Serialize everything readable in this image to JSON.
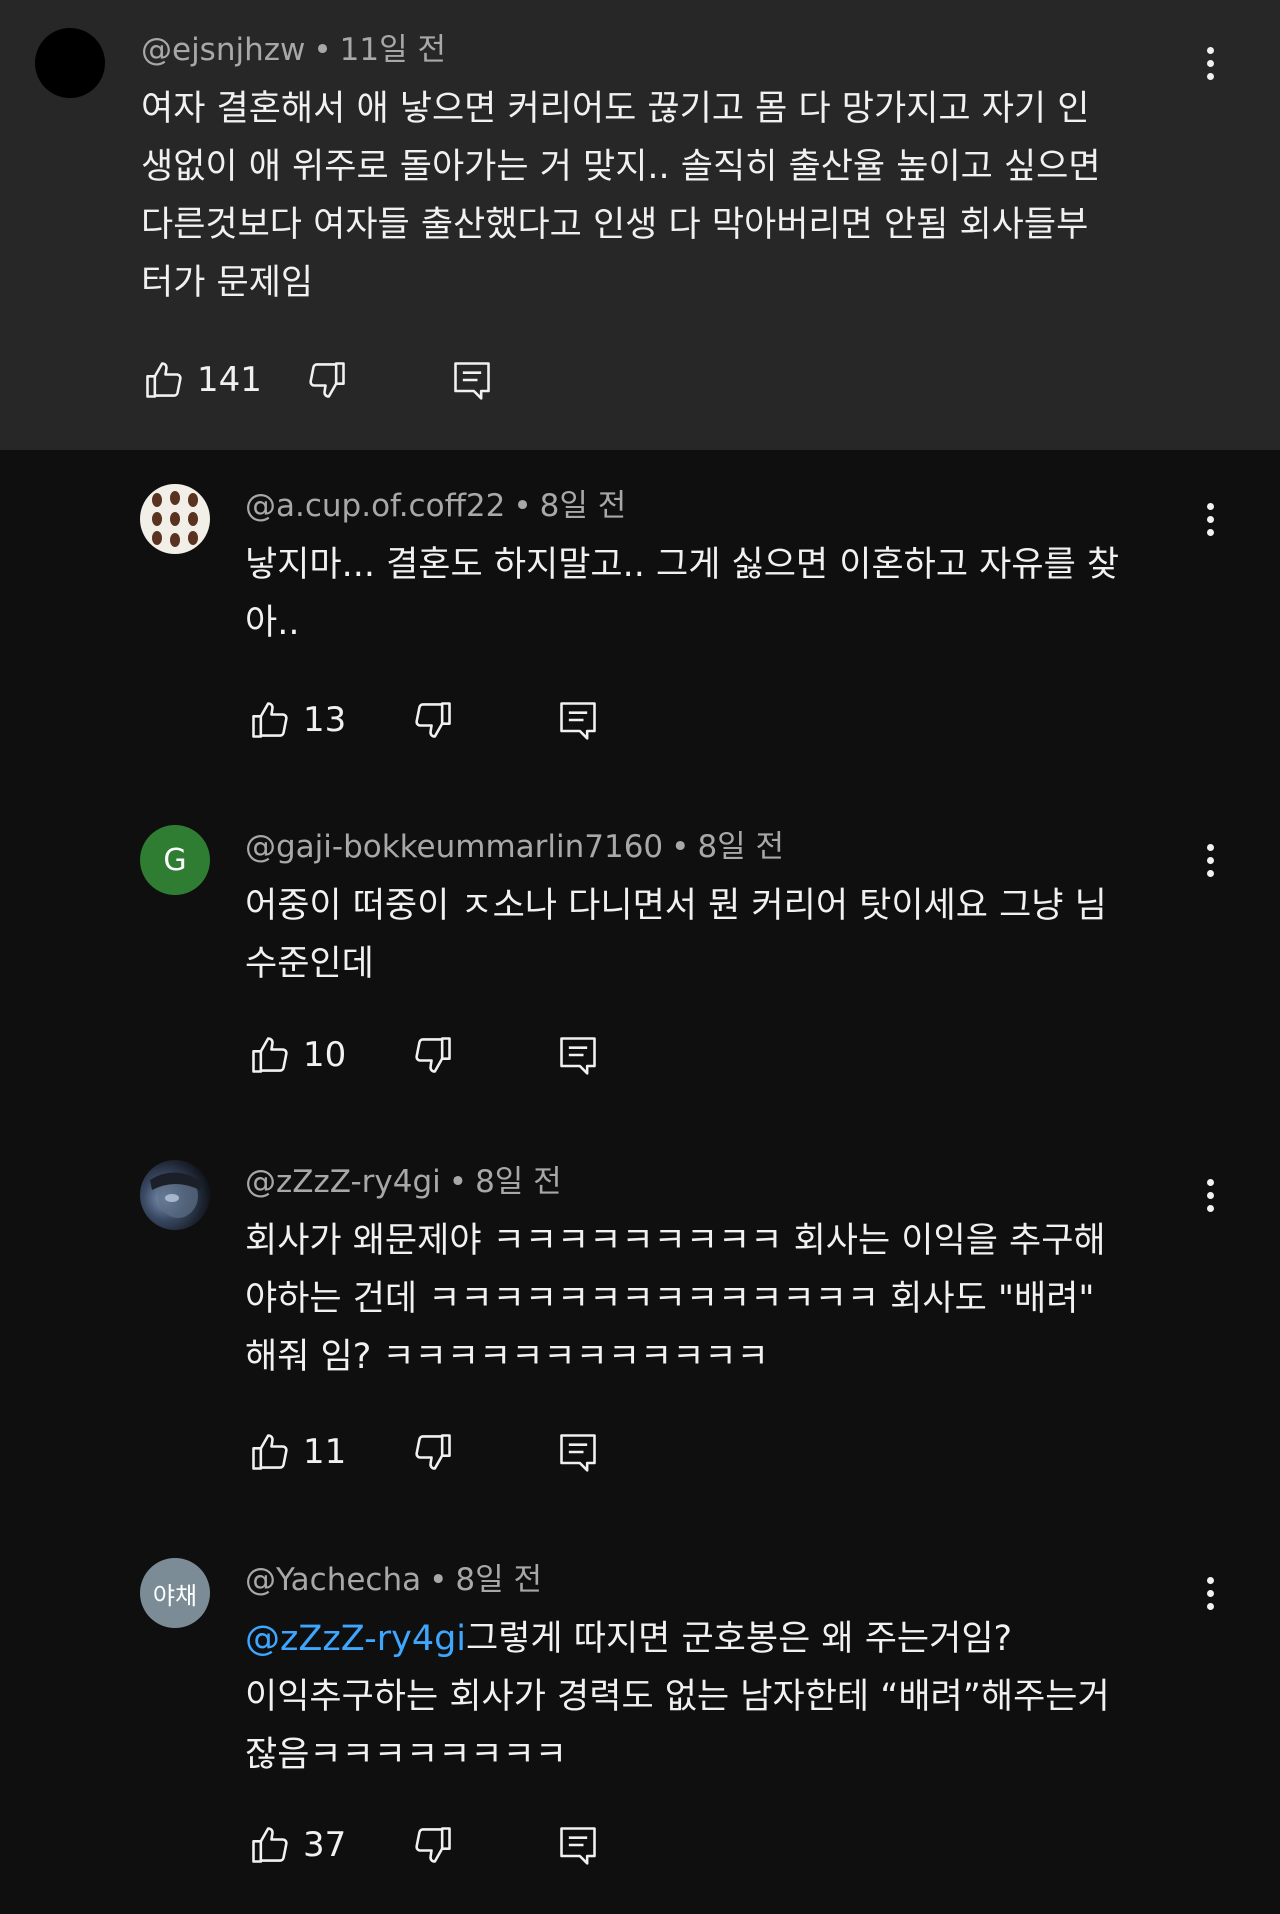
{
  "comments": [
    {
      "handle": "@ejsnjhzw",
      "time": "11일 전",
      "text": "여자 결혼해서 애 낳으면 커리어도 끊기고 몸 다 망가지고 자기 인\n생없이 애 위주로 돌아가는 거 맞지.. 솔직히 출산율 높이고 싶으면\n다른것보다 여자들 출산했다고 인생 다 막아버리면 안됨 회사들부\n터가 문제임",
      "likes": "141"
    },
    {
      "handle": "@a.cup.of.coff22",
      "time": "8일 전",
      "text": "낳지마... 결혼도 하지말고.. 그게 싫으면 이혼하고 자유를 찾\n아..",
      "likes": "13"
    },
    {
      "handle": "@gaji-bokkeummarlin7160",
      "time": "8일 전",
      "avatar_letter": "G",
      "avatar_color": "#2e7d32",
      "text": "어중이 떠중이 ㅈ소나 다니면서 뭔 커리어 탓이세요 그냥 님\n수준인데",
      "likes": "10"
    },
    {
      "handle": "@zZzZ-ry4gi",
      "time": "8일 전",
      "text": "회사가 왜문제야 ㅋㅋㅋㅋㅋㅋㅋㅋㅋ 회사는 이익을 추구해\n야하는 건데 ㅋㅋㅋㅋㅋㅋㅋㅋㅋㅋㅋㅋㅋㅋ 회사도 \"배려\"\n해줘 임? ㅋㅋㅋㅋㅋㅋㅋㅋㅋㅋㅋㅋ",
      "likes": "11"
    },
    {
      "handle": "@Yachecha",
      "time": "8일 전",
      "avatar_letter": "야채",
      "avatar_color": "#7b8c96",
      "mention": "@zZzZ-ry4gi",
      "text": "그렇게 따지면 군호봉은 왜 주는거임?\n이익추구하는 회사가 경력도 없는 남자한테 “배려”해주는거\n잖음ㅋㅋㅋㅋㅋㅋㅋㅋ",
      "likes": "37"
    }
  ],
  "icons": {
    "like": "thumbs-up-icon",
    "dislike": "thumbs-down-icon",
    "reply": "reply-icon",
    "more": "more-vert-icon"
  },
  "colors": {
    "background": "#0f0f0f",
    "highlight_background": "#272727",
    "text": "#f1f1f1",
    "meta": "#a8a8a8",
    "mention": "#3ea6ff"
  }
}
